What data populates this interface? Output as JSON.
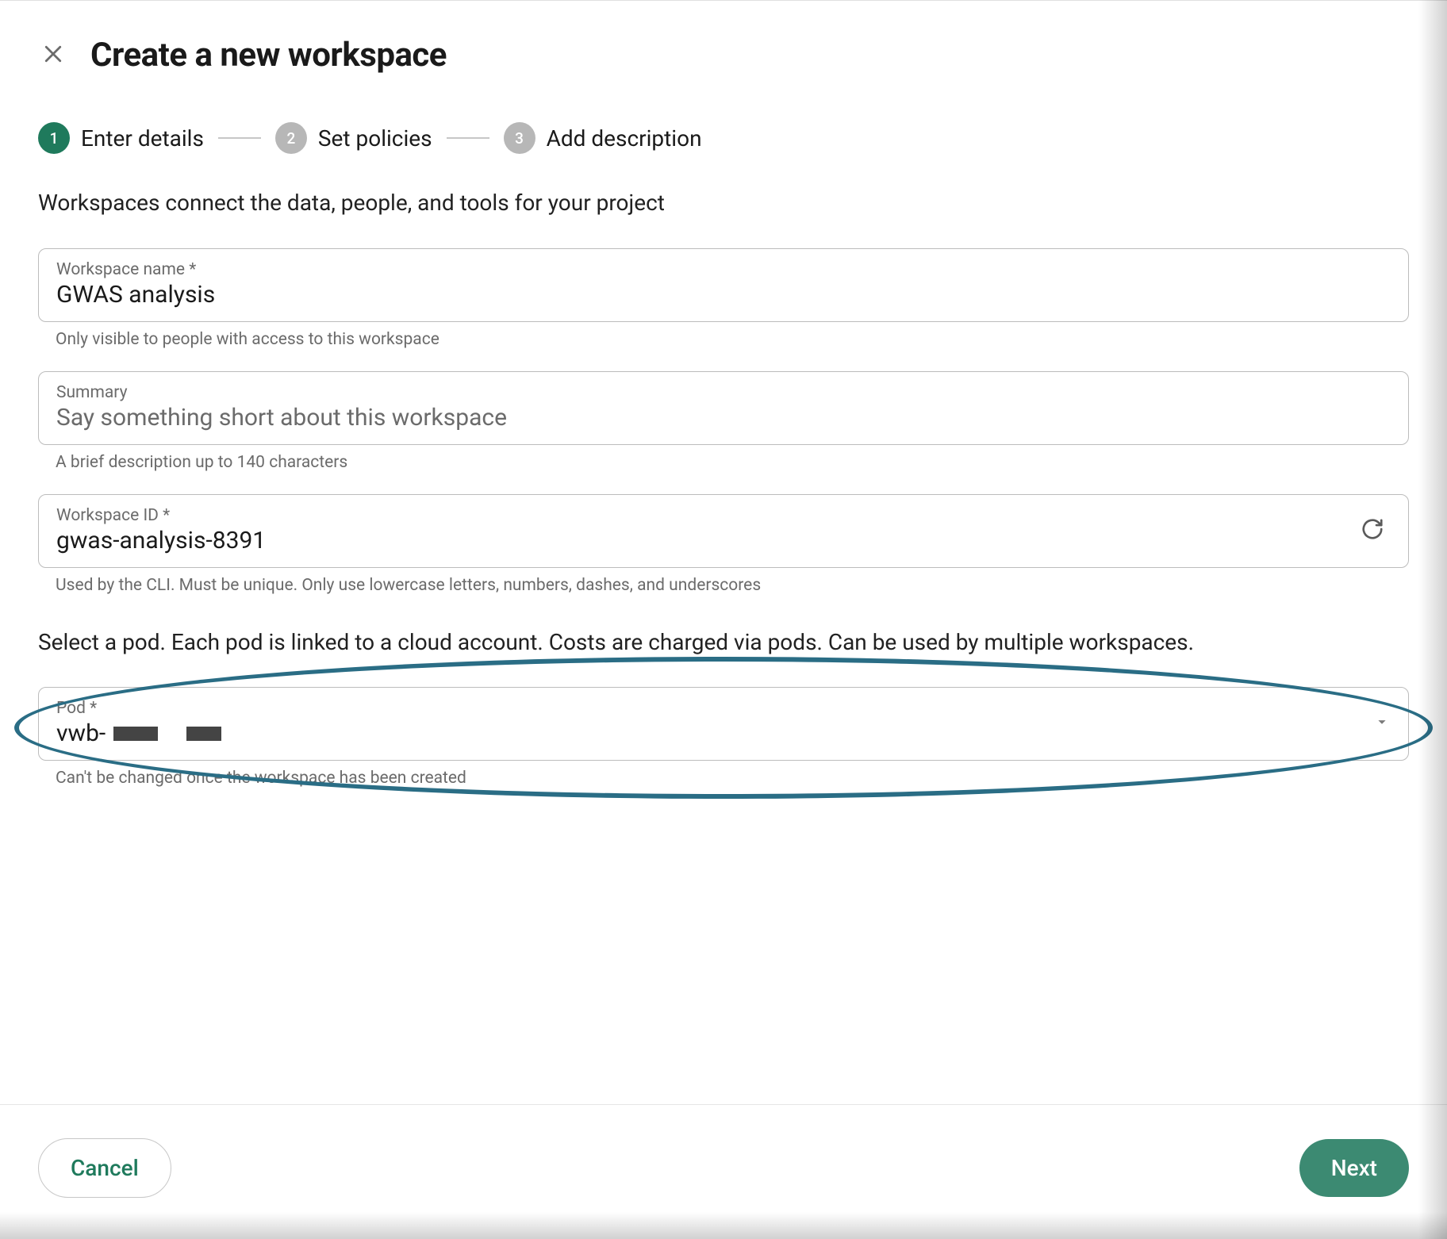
{
  "header": {
    "title": "Create a new workspace"
  },
  "stepper": {
    "steps": [
      {
        "num": "1",
        "label": "Enter details",
        "active": true
      },
      {
        "num": "2",
        "label": "Set policies",
        "active": false
      },
      {
        "num": "3",
        "label": "Add description",
        "active": false
      }
    ]
  },
  "details": {
    "intro": "Workspaces connect the data, people, and tools for your project",
    "name": {
      "label": "Workspace name *",
      "value": "GWAS analysis",
      "hint": "Only visible to people with access to this workspace"
    },
    "summary": {
      "label": "Summary",
      "placeholder": "Say something short about this workspace",
      "value": "",
      "hint": "A brief description up to 140 characters"
    },
    "workspace_id": {
      "label": "Workspace ID *",
      "value": "gwas-analysis-8391",
      "hint": "Used by the CLI. Must be unique. Only use lowercase letters, numbers, dashes, and underscores"
    },
    "pod_intro": "Select a pod. Each pod is linked to a cloud account. Costs are charged via pods. Can be used by multiple workspaces.",
    "pod": {
      "label": "Pod *",
      "value_prefix": "vwb-",
      "hint": "Can't be changed once the workspace has been created"
    }
  },
  "footer": {
    "cancel": "Cancel",
    "next": "Next"
  }
}
